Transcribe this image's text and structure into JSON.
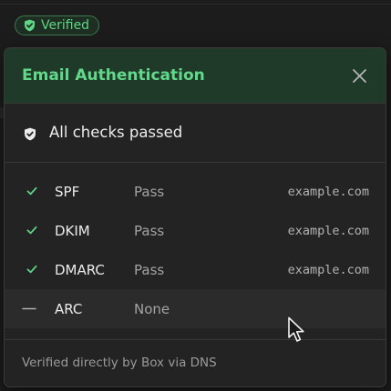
{
  "badge": {
    "label": "Verified",
    "icon": "shield-check-icon"
  },
  "popover": {
    "title": "Email Authentication",
    "close_icon": "close-icon",
    "summary": {
      "icon": "shield-check-icon",
      "text": "All checks passed"
    },
    "checks": [
      {
        "name": "SPF",
        "result": "Pass",
        "domain": "example.com",
        "status": "pass",
        "icon": "check-icon"
      },
      {
        "name": "DKIM",
        "result": "Pass",
        "domain": "example.com",
        "status": "pass",
        "icon": "check-icon"
      },
      {
        "name": "DMARC",
        "result": "Pass",
        "domain": "example.com",
        "status": "pass",
        "icon": "check-icon"
      },
      {
        "name": "ARC",
        "result": "None",
        "domain": "",
        "status": "none",
        "icon": "dash-icon"
      }
    ],
    "footer": "Verified directly by Box via DNS"
  },
  "colors": {
    "accent_green": "#62d98a",
    "header_bg": "#1f3a29",
    "panel_bg": "#232323",
    "page_bg": "#1c1c1c"
  }
}
